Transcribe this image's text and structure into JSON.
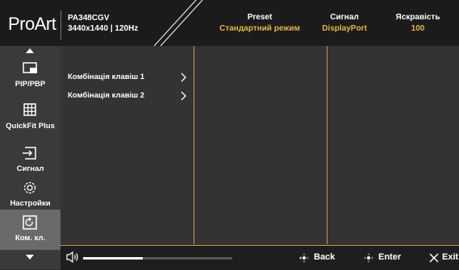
{
  "header": {
    "logo": "ProArt",
    "model": "PA348CGV",
    "resolution": "3440x1440 | 120Hz",
    "preset_label": "Preset",
    "preset_value": "Стандартний режим",
    "signal_label": "Сигнал",
    "signal_value": "DisplayPort",
    "brightness_label": "Яскравість",
    "brightness_value": "100"
  },
  "sidebar": {
    "items": [
      {
        "label": "PIP/PBP",
        "icon": "pip-icon"
      },
      {
        "label": "QuickFit Plus",
        "icon": "grid-icon"
      },
      {
        "label": "Сигнал",
        "icon": "input-signal-icon"
      },
      {
        "label": "Настройки",
        "icon": "gear-icon"
      },
      {
        "label": "Ком. кл.",
        "icon": "shortcut-icon",
        "active": true
      }
    ]
  },
  "menu": {
    "items": [
      {
        "label": "Комбінація клавіш 1"
      },
      {
        "label": "Комбінація клавіш 2"
      }
    ]
  },
  "footer": {
    "volume_fraction": 0.4,
    "back_label": "Back",
    "enter_label": "Enter",
    "exit_label": "Exit"
  },
  "colors": {
    "accent": "#e0b64a",
    "divider": "#c89a3a",
    "active_bg": "#6a6a6a"
  }
}
